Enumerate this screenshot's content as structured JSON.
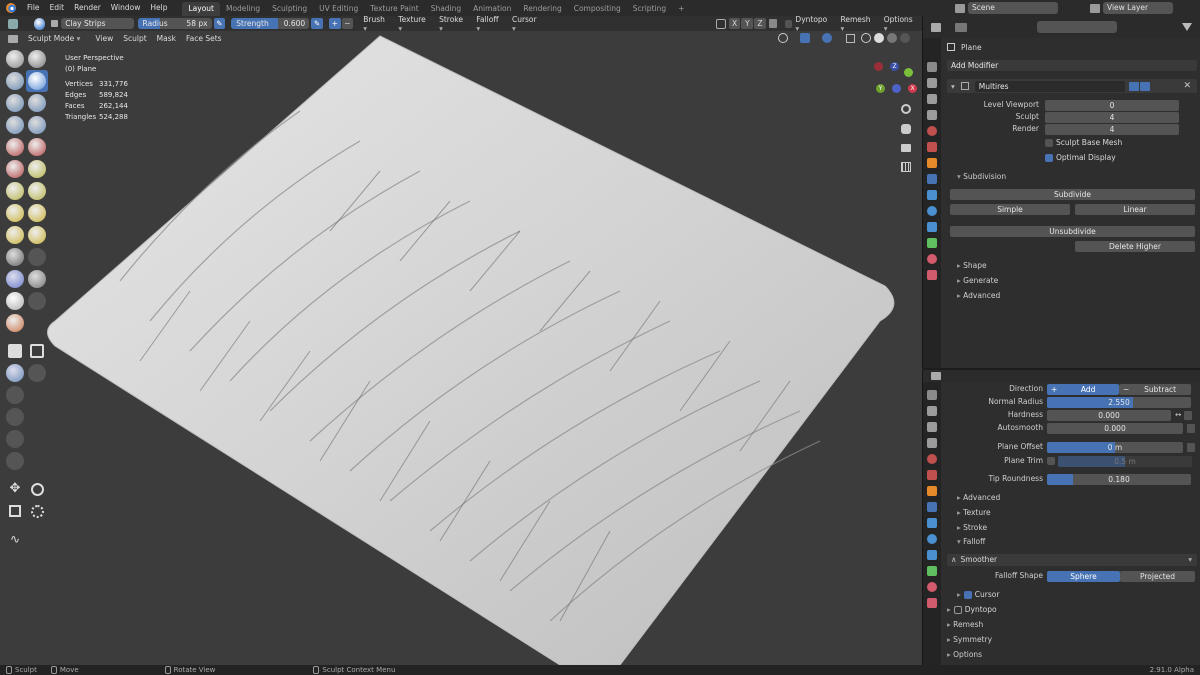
{
  "menu": [
    "File",
    "Edit",
    "Render",
    "Window",
    "Help"
  ],
  "workspaces": [
    "Layout",
    "Modeling",
    "Sculpting",
    "UV Editing",
    "Texture Paint",
    "Shading",
    "Animation",
    "Rendering",
    "Compositing",
    "Scripting"
  ],
  "active_workspace": "Layout",
  "add_workspace": "+",
  "scene": "Scene",
  "view_layer": "View Layer",
  "toolheader": {
    "brush_name": "Clay Strips",
    "radius_label": "Radius",
    "radius_value": "58 px",
    "strength_label": "Strength",
    "strength_value": "0.600",
    "plus": "+",
    "minus": "−",
    "brush_dd": "Brush",
    "texture_dd": "Texture",
    "stroke_dd": "Stroke",
    "falloff_dd": "Falloff",
    "cursor_dd": "Cursor",
    "axis_x": "X",
    "axis_y": "Y",
    "axis_z": "Z",
    "dyntopo": "Dyntopo",
    "remesh": "Remesh",
    "options": "Options"
  },
  "viewheader": {
    "mode": "Sculpt Mode",
    "view": "View",
    "sculpt": "Sculpt",
    "mask": "Mask",
    "face_sets": "Face Sets"
  },
  "overlay": {
    "perspective": "User Perspective",
    "object": "(0) Plane",
    "stats": [
      {
        "label": "Vertices",
        "value": "331,776"
      },
      {
        "label": "Edges",
        "value": "589,824"
      },
      {
        "label": "Faces",
        "value": "262,144"
      },
      {
        "label": "Triangles",
        "value": "524,288"
      }
    ]
  },
  "gizmo": {
    "x": "X",
    "y": "Y",
    "z": "Z"
  },
  "statusbar": {
    "sculpt": "Sculpt",
    "move": "Move",
    "rotate": "Rotate View",
    "context": "Sculpt Context Menu",
    "version": "2.91.0 Alpha"
  },
  "props": {
    "object_name": "Plane",
    "add_modifier": "Add Modifier",
    "modifier_name": "Multires",
    "level_viewport_label": "Level Viewport",
    "level_viewport": "0",
    "sculpt_label": "Sculpt",
    "sculpt_value": "4",
    "render_label": "Render",
    "render_value": "4",
    "sculpt_base_mesh": "Sculpt Base Mesh",
    "optimal_display": "Optimal Display",
    "subdivision": "Subdivision",
    "subdivide": "Subdivide",
    "simple": "Simple",
    "linear": "Linear",
    "unsubdivide": "Unsubdivide",
    "delete_higher": "Delete Higher",
    "shape": "Shape",
    "generate": "Generate",
    "advanced": "Advanced"
  },
  "brush": {
    "direction_label": "Direction",
    "add": "Add",
    "subtract": "Subtract",
    "normal_radius_label": "Normal Radius",
    "normal_radius": "2.550",
    "normal_radius_fill": 0.6,
    "hardness_label": "Hardness",
    "hardness": "0.000",
    "autosmooth_label": "Autosmooth",
    "autosmooth": "0.000",
    "plane_offset_label": "Plane Offset",
    "plane_offset": "0 m",
    "plane_trim_label": "Plane Trim",
    "plane_trim": "0.5 m",
    "tip_roundness_label": "Tip Roundness",
    "tip_roundness": "0.180",
    "tip_roundness_fill": 0.18,
    "advanced": "Advanced",
    "texture": "Texture",
    "stroke": "Stroke",
    "falloff": "Falloff",
    "falloff_preset": "Smoother",
    "falloff_shape_label": "Falloff Shape",
    "sphere": "Sphere",
    "projected": "Projected",
    "cursor": "Cursor",
    "dyntopo": "Dyntopo",
    "remesh": "Remesh",
    "symmetry": "Symmetry",
    "options": "Options"
  },
  "colors": {
    "accent": "#4772b3",
    "viewport": "#3c3c3c",
    "mesh": "#d9d9d9"
  }
}
